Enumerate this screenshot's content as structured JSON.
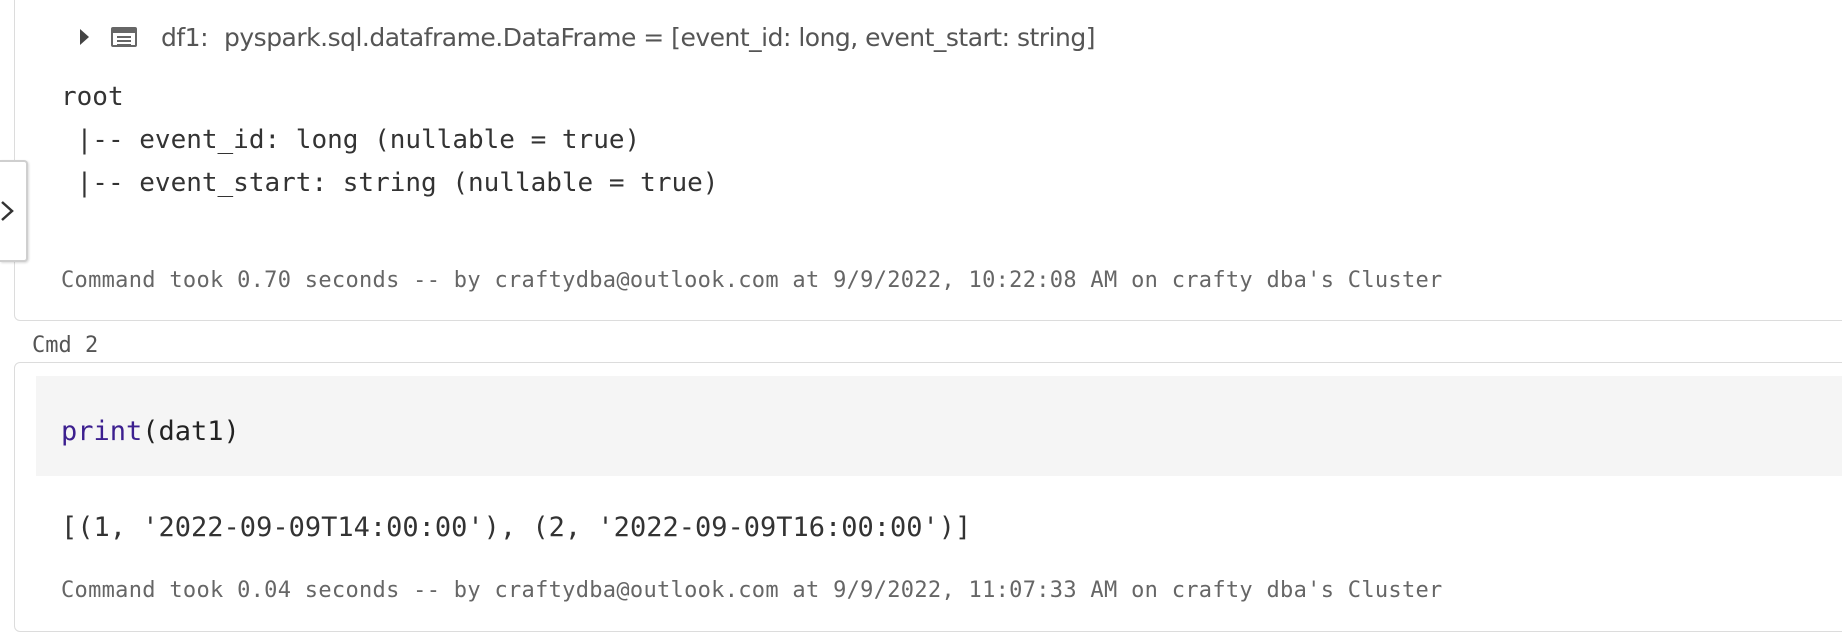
{
  "cell1": {
    "dataframe_row": {
      "name": "df1:",
      "type": "pyspark.sql.dataframe.DataFrame = [event_id: long, event_start: string]"
    },
    "schema_lines": [
      "root",
      " |-- event_id: long (nullable = true)",
      " |-- event_start: string (nullable = true)"
    ],
    "command_took": "Command took 0.70 seconds -- by craftydba@outlook.com at 9/9/2022, 10:22:08 AM on crafty dba's Cluster"
  },
  "cell2": {
    "label": "Cmd 2",
    "code": {
      "function": "print",
      "args": "(dat1)"
    },
    "output": "[(1, '2022-09-09T14:00:00'), (2, '2022-09-09T16:00:00')]",
    "command_took": "Command took 0.04 seconds -- by craftydba@outlook.com at 9/9/2022, 11:07:33 AM on crafty dba's Cluster"
  },
  "side_panel": {
    "toggle_icon": "chevron-right-icon"
  }
}
